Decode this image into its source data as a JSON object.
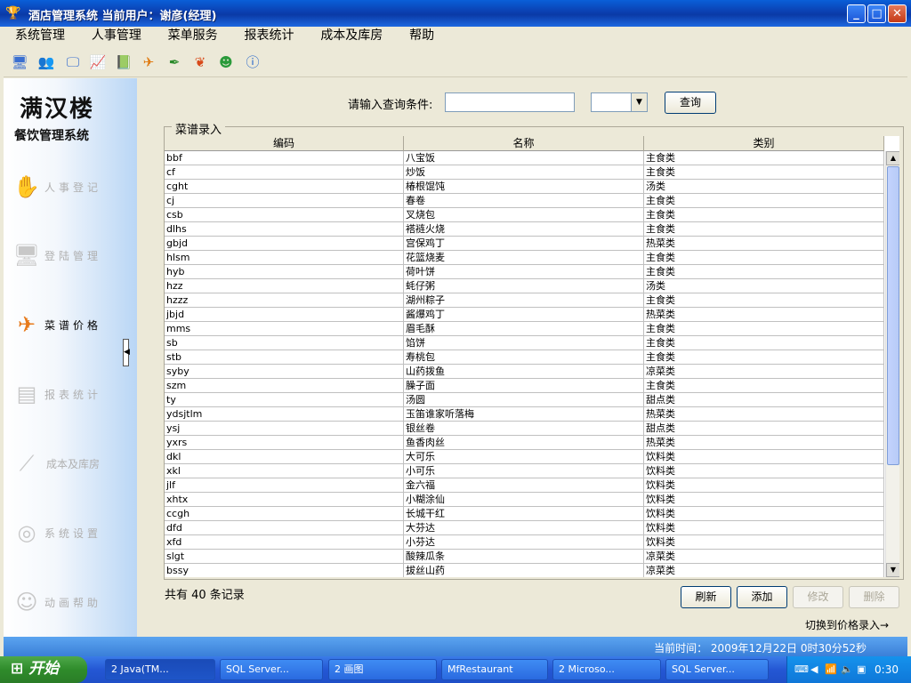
{
  "window": {
    "title": "酒店管理系统    当前用户：谢彦(经理)",
    "buttons": {
      "min": "_",
      "max": "□",
      "close": "✕"
    }
  },
  "menu": [
    "系统管理",
    "人事管理",
    "菜单服务",
    "报表统计",
    "成本及库房",
    "帮助"
  ],
  "toolbar_icons": [
    "computer-icon",
    "users-icon",
    "monitor-icon",
    "chart-icon",
    "book-icon",
    "plane-icon",
    "pen-icon",
    "butterfly-icon",
    "person-icon",
    "info-icon"
  ],
  "sidebar": {
    "logo_title": "满汉楼",
    "logo_subtitle": "餐饮管理系统",
    "items": [
      {
        "label": "人事登记",
        "icon": "handshake-icon",
        "active": false
      },
      {
        "label": "登陆管理",
        "icon": "computer-icon",
        "active": false
      },
      {
        "label": "菜谱价格",
        "icon": "plane-icon",
        "active": true
      },
      {
        "label": "报表统计",
        "icon": "report-icon",
        "active": false
      },
      {
        "label": "成本及库房",
        "icon": "knife-icon",
        "active": false
      },
      {
        "label": "系统设置",
        "icon": "disc-icon",
        "active": false
      },
      {
        "label": "动画帮助",
        "icon": "person-icon",
        "active": false
      }
    ]
  },
  "search": {
    "label": "请输入查询条件:",
    "value": "",
    "combo_value": "",
    "button": "查询"
  },
  "group_title": "菜谱录入",
  "table": {
    "columns": [
      "编码",
      "名称",
      "类别"
    ],
    "rows": [
      [
        "bbf",
        "八宝饭",
        "主食类"
      ],
      [
        "cf",
        "炒饭",
        "主食类"
      ],
      [
        "cght",
        "椿根馄饨",
        "汤类"
      ],
      [
        "cj",
        "春卷",
        "主食类"
      ],
      [
        "csb",
        "叉烧包",
        "主食类"
      ],
      [
        "dlhs",
        "褡裢火烧",
        "主食类"
      ],
      [
        "gbjd",
        "宫保鸡丁",
        "热菜类"
      ],
      [
        "hlsm",
        "花篮烧麦",
        "主食类"
      ],
      [
        "hyb",
        "荷叶饼",
        "主食类"
      ],
      [
        "hzz",
        "蚝仔粥",
        "汤类"
      ],
      [
        "hzzz",
        "湖州粽子",
        "主食类"
      ],
      [
        "jbjd",
        "酱爆鸡丁",
        "热菜类"
      ],
      [
        "mms",
        "眉毛酥",
        "主食类"
      ],
      [
        "sb",
        "馅饼",
        "主食类"
      ],
      [
        "stb",
        "寿桃包",
        "主食类"
      ],
      [
        "syby",
        "山药拨鱼",
        "凉菜类"
      ],
      [
        "szm",
        "臊子面",
        "主食类"
      ],
      [
        "ty",
        "汤圆",
        "甜点类"
      ],
      [
        "ydsjtlm",
        "玉笛谁家听落梅",
        "热菜类"
      ],
      [
        "ysj",
        "银丝卷",
        "甜点类"
      ],
      [
        "yxrs",
        "鱼香肉丝",
        "热菜类"
      ],
      [
        "dkl",
        "大可乐",
        "饮料类"
      ],
      [
        "xkl",
        "小可乐",
        "饮料类"
      ],
      [
        "jlf",
        "金六福",
        "饮料类"
      ],
      [
        "xhtx",
        "小糊涂仙",
        "饮料类"
      ],
      [
        "ccgh",
        "长城干红",
        "饮料类"
      ],
      [
        "dfd",
        "大芬达",
        "饮料类"
      ],
      [
        "xfd",
        "小芬达",
        "饮料类"
      ],
      [
        "slgt",
        "酸辣瓜条",
        "凉菜类"
      ],
      [
        "bssy",
        "拔丝山药",
        "凉菜类"
      ]
    ]
  },
  "footer": {
    "count_text": "共有  40  条记录",
    "buttons": {
      "refresh": "刷新",
      "add": "添加",
      "edit": "修改",
      "delete": "删除"
    },
    "switch_link": "切换到价格录入→"
  },
  "status": {
    "time": "当前时间：  2009年12月22日  0时30分52秒"
  },
  "taskbar": {
    "start": "开始",
    "tasks": [
      "2 Java(TM...",
      "SQL Server...",
      "2 画图",
      "MfRestaurant",
      "2 Microso...",
      "SQL Server..."
    ],
    "clock": "0:30"
  }
}
